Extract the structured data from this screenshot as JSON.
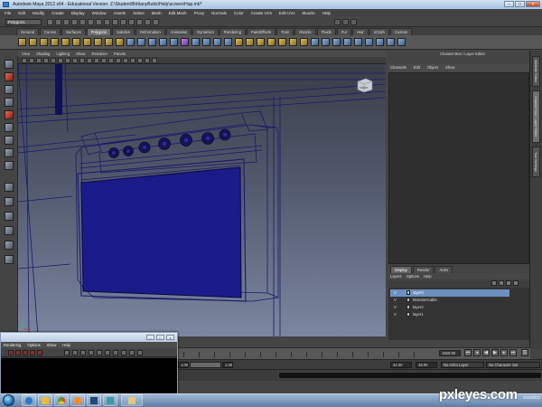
{
  "window": {
    "title": "Autodesk Maya 2012 x64 - Educational Version: Z:\\Student\\BrittanyButts\\Help\\screen\\Hap.mb*",
    "min_label": "–",
    "max_label": "□",
    "close_label": "×"
  },
  "menubar": [
    "File",
    "Edit",
    "Modify",
    "Create",
    "Display",
    "Window",
    "Assets",
    "Select",
    "Mesh",
    "Edit Mesh",
    "Proxy",
    "Normals",
    "Color",
    "Create UVs",
    "Edit UVs",
    "Muscle",
    "Help"
  ],
  "status": {
    "mode": "Polygons"
  },
  "shelf_tabs": [
    {
      "label": "General"
    },
    {
      "label": "Curves"
    },
    {
      "label": "Surfaces"
    },
    {
      "label": "Polygons",
      "active": true
    },
    {
      "label": "Subdivs"
    },
    {
      "label": "Deformation"
    },
    {
      "label": "Animation"
    },
    {
      "label": "Dynamics"
    },
    {
      "label": "Rendering"
    },
    {
      "label": "PaintEffects"
    },
    {
      "label": "Toon"
    },
    {
      "label": "Muscle"
    },
    {
      "label": "Fluids"
    },
    {
      "label": "Fur"
    },
    {
      "label": "Hair"
    },
    {
      "label": "nCloth"
    },
    {
      "label": "Custom"
    }
  ],
  "panel_menu": [
    "View",
    "Shading",
    "Lighting",
    "Show",
    "Renderer",
    "Panels"
  ],
  "viewcube_label": "FRONT",
  "channel_box": {
    "title": "Channel Box / Layer Editor",
    "menu": [
      "Channels",
      "Edit",
      "Object",
      "Show"
    ]
  },
  "side_tabs": [
    {
      "label": "Attribute Editor"
    },
    {
      "label": "Channel Box / Layer Editor",
      "active": true
    },
    {
      "label": "Tool Settings"
    }
  ],
  "layer_editor": {
    "tabs": [
      {
        "label": "Display",
        "active": true
      },
      {
        "label": "Render"
      },
      {
        "label": "Anim"
      }
    ],
    "menu": [
      "Layers",
      "Options",
      "Help"
    ],
    "layers": [
      {
        "v": "V",
        "name": "layer3",
        "selected": true
      },
      {
        "v": "V",
        "name": "MonsterCable"
      },
      {
        "v": "V",
        "name": "layer2"
      },
      {
        "v": "V",
        "name": "layer1"
      }
    ]
  },
  "timeline": {
    "current_frame": "1920.00"
  },
  "range": {
    "start": "1.00",
    "end": "1.00",
    "anim_end": "24.00",
    "end2": "48.00",
    "anim_layer": "No Anim Layer",
    "character": "No Character Set"
  },
  "render_window": {
    "menu": [
      "Rendering",
      "Options",
      "Show",
      "Help"
    ]
  },
  "clock": {
    "time": "",
    "date": "6/14/2012"
  },
  "watermark": "pxleyes.com",
  "taskbar_apps": [
    {
      "name": "ie-icon",
      "color": "#2a78c9"
    },
    {
      "name": "explorer-icon",
      "color": "#e8b93a"
    },
    {
      "name": "chrome-icon",
      "color": "#d94a35"
    },
    {
      "name": "media-player-icon",
      "color": "#ff8a1f"
    },
    {
      "name": "photoshop-icon",
      "color": "#1f4a7a"
    },
    {
      "name": "maya-icon",
      "color": "#3b9aa8"
    },
    {
      "name": "folder-icon",
      "color": "#e0c882"
    }
  ]
}
